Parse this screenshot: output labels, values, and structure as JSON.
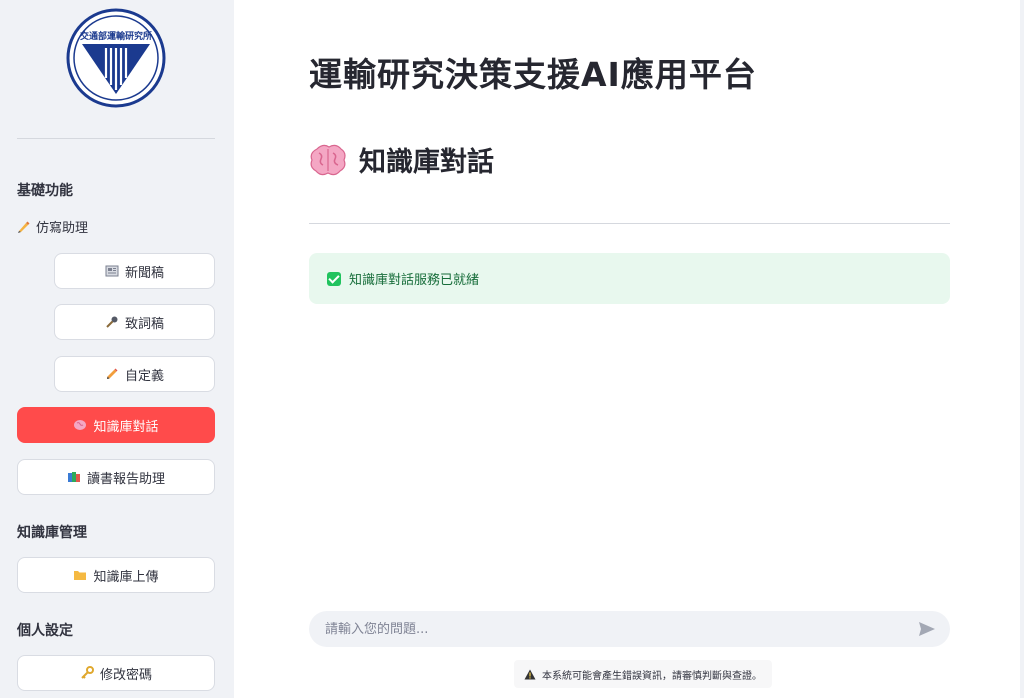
{
  "sidebar": {
    "logo_text": "交通部運輸研究所",
    "section_basic": "基礎功能",
    "sub_writing": "仿寫助理",
    "items": [
      {
        "label": "新聞稿",
        "icon": "newspaper-icon"
      },
      {
        "label": "致詞稿",
        "icon": "microphone-icon"
      },
      {
        "label": "自定義",
        "icon": "pencil-icon"
      },
      {
        "label": "知識庫對話",
        "icon": "brain-icon",
        "active": true
      },
      {
        "label": "讀書報告助理",
        "icon": "books-icon"
      }
    ],
    "section_kb": "知識庫管理",
    "kb_upload": "知識庫上傳",
    "section_personal": "個人設定",
    "change_password": "修改密碼"
  },
  "main": {
    "app_title": "運輸研究決策支援AI應用平台",
    "page_title": "知識庫對話",
    "status_message": "知識庫對話服務已就緒",
    "chat_placeholder": "請輸入您的問題...",
    "disclaimer": "本系統可能會產生錯誤資訊，請審慎判斷與查證。"
  },
  "colors": {
    "accent": "#ff4b4b",
    "sidebar_bg": "#f0f2f6",
    "success_bg": "#e8f8ee",
    "success_text": "#176d3a",
    "logo_blue": "#1b3a8f"
  }
}
